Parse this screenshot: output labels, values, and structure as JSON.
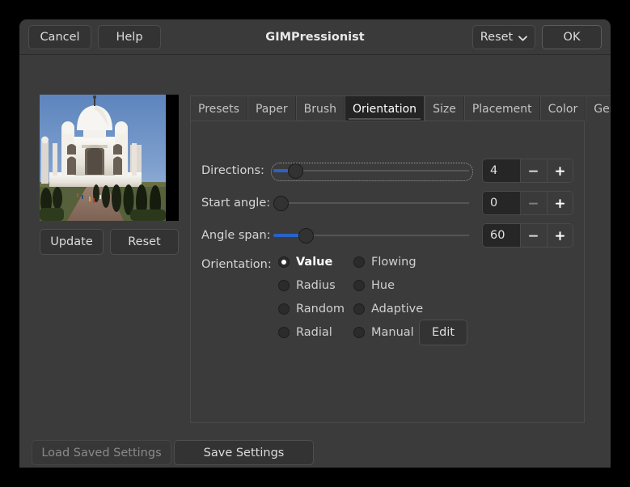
{
  "window": {
    "title": "GIMPressionist",
    "header": {
      "cancel_label": "Cancel",
      "help_label": "Help",
      "reset_label": "Reset",
      "reset_icon": "chevron-down-icon",
      "ok_label": "OK"
    }
  },
  "preview": {
    "image_alt": "taj-mahal-preview",
    "update_label": "Update",
    "reset_label": "Reset"
  },
  "tabs": [
    {
      "label": "Presets",
      "active": false
    },
    {
      "label": "Paper",
      "active": false
    },
    {
      "label": "Brush",
      "active": false
    },
    {
      "label": "Orientation",
      "active": true
    },
    {
      "label": "Size",
      "active": false
    },
    {
      "label": "Placement",
      "active": false
    },
    {
      "label": "Color",
      "active": false
    },
    {
      "label": "General",
      "active": false
    }
  ],
  "orientation_page": {
    "sliders": [
      {
        "label": "Directions:",
        "value": "4",
        "thumb_percent": 11,
        "fill_percent": 11,
        "focused": true,
        "minus_enabled": true,
        "plus_enabled": true
      },
      {
        "label": "Start angle:",
        "value": "0",
        "thumb_percent": 0,
        "fill_percent": 0,
        "focused": false,
        "minus_enabled": false,
        "plus_enabled": true
      },
      {
        "label": "Angle span:",
        "value": "60",
        "thumb_percent": 17,
        "fill_percent": 17,
        "focused": false,
        "minus_enabled": true,
        "plus_enabled": true
      }
    ],
    "orientation_label": "Orientation:",
    "radios_left": [
      {
        "label": "Value",
        "checked": true
      },
      {
        "label": "Radius",
        "checked": false
      },
      {
        "label": "Random",
        "checked": false
      },
      {
        "label": "Radial",
        "checked": false
      }
    ],
    "radios_right": [
      {
        "label": "Flowing",
        "checked": false
      },
      {
        "label": "Hue",
        "checked": false
      },
      {
        "label": "Adaptive",
        "checked": false
      },
      {
        "label": "Manual",
        "checked": false
      }
    ],
    "edit_label": "Edit"
  },
  "footer": {
    "load_label": "Load Saved Settings",
    "load_enabled": false,
    "save_label": "Save Settings",
    "save_enabled": true
  },
  "colors": {
    "window_bg": "#3b3b3b",
    "headerbar_bg": "#3a3a3a",
    "button_bg": "#333333",
    "active_tab_bg": "#242424",
    "entry_bg": "#262626",
    "slider_accent": "#2a62c4",
    "text": "#d6d6d6",
    "text_disabled": "#8a8a8a",
    "desktop_bg": "#000000"
  }
}
